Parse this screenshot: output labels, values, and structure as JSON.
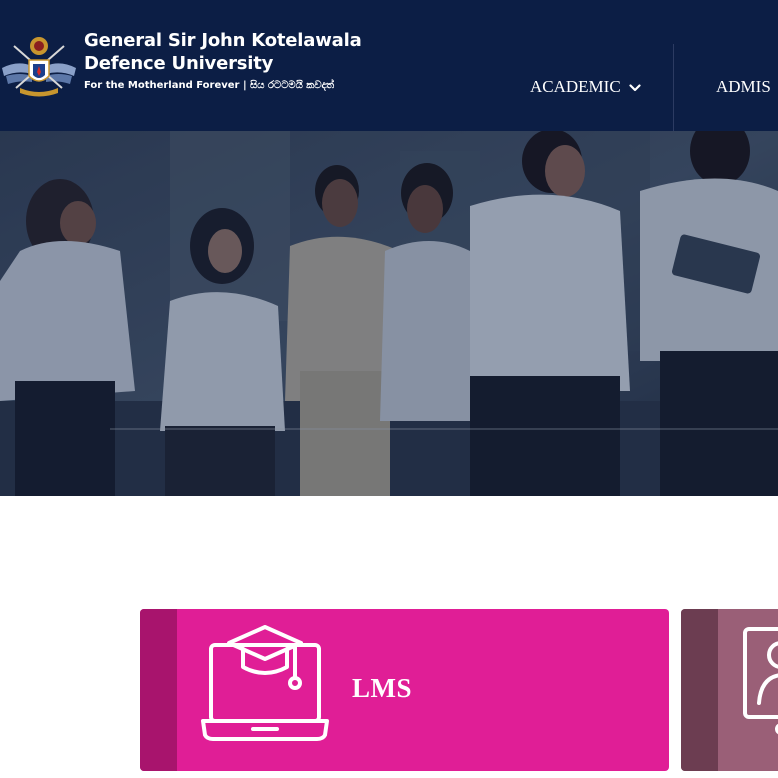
{
  "header": {
    "university_name_line1": "General Sir John Kotelawala",
    "university_name_line2": "Defence University",
    "tagline": "For the Motherland Forever | සිය රටටමයි කවදත්",
    "nav": {
      "academic_label": "ACADEMIC",
      "admissions_label_visible": "ADMIS"
    }
  },
  "hero": {
    "image": "students-in-uniform-photo"
  },
  "cards": {
    "lms": {
      "label": "LMS",
      "icon": "laptop-graduation-cap-icon",
      "color": "#e01e96",
      "stripe_color": "#a8146d"
    },
    "second": {
      "icon": "portal-user-icon",
      "color": "#9a5f77",
      "stripe_color": "#6c3d51"
    }
  },
  "colors": {
    "header_bg": "#0c1e45",
    "page_bg": "#ffffff"
  }
}
